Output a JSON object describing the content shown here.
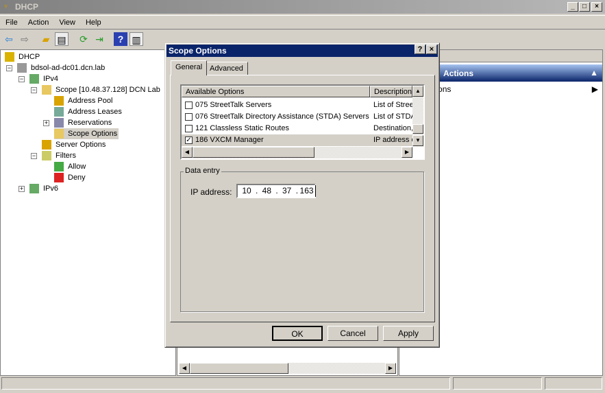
{
  "window": {
    "title": "DHCP",
    "controls": [
      "minimize",
      "maximize",
      "close"
    ]
  },
  "menu": [
    "File",
    "Action",
    "View",
    "Help"
  ],
  "toolbar": [
    {
      "icon": "back-icon"
    },
    {
      "icon": "forward-icon"
    },
    {
      "icon": "up-folder-icon"
    },
    {
      "icon": "show-hide-tree-icon"
    },
    {
      "icon": "refresh-icon"
    },
    {
      "icon": "export-list-icon"
    },
    {
      "icon": "help-icon"
    },
    {
      "icon": "show-hide-action-pane-icon"
    }
  ],
  "tree": [
    {
      "label": "DHCP",
      "level": 0
    },
    {
      "label": "bdsol-ad-dc01.dcn.lab",
      "level": 1,
      "expander": "−"
    },
    {
      "label": "IPv4",
      "level": 2,
      "expander": "−"
    },
    {
      "label": "Scope [10.48.37.128] DCN Lab",
      "level": 3,
      "expander": "−"
    },
    {
      "label": "Address Pool",
      "level": 4
    },
    {
      "label": "Address Leases",
      "level": 4
    },
    {
      "label": "Reservations",
      "level": 4,
      "expander": "+"
    },
    {
      "label": "Scope Options",
      "level": 4,
      "selected": true
    },
    {
      "label": "Server Options",
      "level": 3
    },
    {
      "label": "Filters",
      "level": 3,
      "expander": "−"
    },
    {
      "label": "Allow",
      "level": 4
    },
    {
      "label": "Deny",
      "level": 4
    },
    {
      "label": "IPv6",
      "level": 2,
      "expander": "+"
    }
  ],
  "actions": {
    "header": "Actions",
    "item": "More Actions"
  },
  "dialog": {
    "title": "Scope Options",
    "tabs": [
      "General",
      "Advanced"
    ],
    "active_tab": "General",
    "columns": [
      "Available Options",
      "Description"
    ],
    "options": [
      {
        "name": "075 StreetTalk Servers",
        "description": "List of StreetTalk",
        "checked": false
      },
      {
        "name": "076 StreetTalk Directory Assistance (STDA) Servers",
        "description": "List of STDA",
        "checked": false
      },
      {
        "name": "121 Classless Static Routes",
        "description": "Destination,",
        "checked": false
      },
      {
        "name": "186 VXCM Manager",
        "description": "IP address of",
        "checked": true
      }
    ],
    "data_entry": {
      "legend": "Data entry",
      "ip_label": "IP address:",
      "ip": [
        "10",
        "48",
        "37",
        "163"
      ]
    },
    "buttons": {
      "ok": "OK",
      "cancel": "Cancel",
      "apply": "Apply"
    }
  }
}
